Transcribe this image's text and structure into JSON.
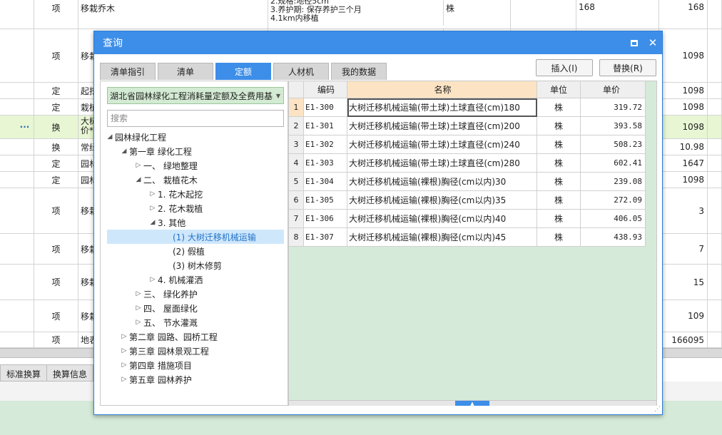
{
  "background": {
    "rows": [
      {
        "type": "项",
        "name": "移栽乔木",
        "spec": "2.规格:地径5cm\n3.养护期: 保存养护三个月\n4.1km内移植",
        "unit": "株",
        "qty": "168",
        "total": "168"
      },
      {
        "type": "项",
        "name": "移栽",
        "spec": "",
        "unit": "",
        "qty": "",
        "total": "1098"
      },
      {
        "type": "定",
        "name": "起挖",
        "spec": "",
        "unit": "",
        "qty": "",
        "total": "1098"
      },
      {
        "type": "定",
        "name": "栽植",
        "spec": "",
        "unit": "",
        "qty": "",
        "total": "1098"
      },
      {
        "type": "换",
        "name": "大树\n价*",
        "spec": "",
        "unit": "",
        "qty": "",
        "total": "1098",
        "dots": "···"
      },
      {
        "type": "换",
        "name": "常绿",
        "spec": "",
        "unit": "",
        "qty": "",
        "total": "10.98"
      },
      {
        "type": "定",
        "name": "园林",
        "spec": "",
        "unit": "",
        "qty": "",
        "total": "1647"
      },
      {
        "type": "定",
        "name": "园林",
        "spec": "",
        "unit": "",
        "qty": "",
        "total": "1098"
      },
      {
        "type": "项",
        "name": "移栽",
        "spec": "",
        "unit": "",
        "qty": "",
        "total": "3"
      },
      {
        "type": "项",
        "name": "移栽",
        "spec": "",
        "unit": "",
        "qty": "",
        "total": "7"
      },
      {
        "type": "项",
        "name": "移栽",
        "spec": "",
        "unit": "",
        "qty": "",
        "total": "15"
      },
      {
        "type": "项",
        "name": "移栽",
        "spec": "",
        "unit": "",
        "qty": "",
        "total": "109"
      },
      {
        "type": "项",
        "name": "地表",
        "spec": "",
        "unit": "",
        "qty": "",
        "total": "166095"
      }
    ],
    "bottom_tabs": [
      "标准换算",
      "换算信息"
    ]
  },
  "dialog": {
    "title": "查询",
    "tabs": [
      {
        "label": "清单指引",
        "active": false
      },
      {
        "label": "清单",
        "active": false
      },
      {
        "label": "定额",
        "active": true
      },
      {
        "label": "人材机",
        "active": false
      },
      {
        "label": "我的数据",
        "active": false
      }
    ],
    "insert_button": "插入(I)",
    "replace_button": "替换(R)",
    "library_select": "湖北省园林绿化工程消耗量定额及全费用基",
    "search_placeholder": "搜索",
    "tree": [
      {
        "label": "园林绿化工程",
        "toggle": "◢"
      },
      {
        "label": "第一章 绿化工程",
        "toggle": "◢"
      },
      {
        "label": "一、  绿地整理",
        "toggle": "▷"
      },
      {
        "label": "二、  栽植花木",
        "toggle": "◢"
      },
      {
        "label": "1. 花木起挖",
        "toggle": "▷"
      },
      {
        "label": "2. 花木栽植",
        "toggle": "▷"
      },
      {
        "label": "3. 其他",
        "toggle": "◢"
      },
      {
        "label": "(1) 大树迁移机械运输",
        "toggle": ""
      },
      {
        "label": "(2) 假植",
        "toggle": ""
      },
      {
        "label": "(3) 树木修剪",
        "toggle": ""
      },
      {
        "label": "4. 机械灌洒",
        "toggle": "▷"
      },
      {
        "label": "三、  绿化养护",
        "toggle": "▷"
      },
      {
        "label": "四、  屋面绿化",
        "toggle": "▷"
      },
      {
        "label": "五、  节水灌溉",
        "toggle": "▷"
      },
      {
        "label": "第二章 园路、园桥工程",
        "toggle": "▷"
      },
      {
        "label": "第三章 园林景观工程",
        "toggle": "▷"
      },
      {
        "label": "第四章 措施项目",
        "toggle": "▷"
      },
      {
        "label": "第五章 园林养护",
        "toggle": "▷"
      }
    ],
    "grid": {
      "headers": {
        "code": "编码",
        "name": "名称",
        "unit": "单位",
        "price": "单价"
      },
      "rows": [
        {
          "idx": "1",
          "code": "E1-300",
          "name": "大树迁移机械运输(带土球)土球直径(cm)180",
          "unit": "株",
          "price": "319.72"
        },
        {
          "idx": "2",
          "code": "E1-301",
          "name": "大树迁移机械运输(带土球)土球直径(cm)200",
          "unit": "株",
          "price": "393.58"
        },
        {
          "idx": "3",
          "code": "E1-302",
          "name": "大树迁移机械运输(带土球)土球直径(cm)240",
          "unit": "株",
          "price": "508.23"
        },
        {
          "idx": "4",
          "code": "E1-303",
          "name": "大树迁移机械运输(带土球)土球直径(cm)280",
          "unit": "株",
          "price": "602.41"
        },
        {
          "idx": "5",
          "code": "E1-304",
          "name": "大树迁移机械运输(裸根)胸径(cm以内)30",
          "unit": "株",
          "price": "239.08"
        },
        {
          "idx": "6",
          "code": "E1-305",
          "name": "大树迁移机械运输(裸根)胸径(cm以内)35",
          "unit": "株",
          "price": "272.09"
        },
        {
          "idx": "7",
          "code": "E1-306",
          "name": "大树迁移机械运输(裸根)胸径(cm以内)40",
          "unit": "株",
          "price": "406.05"
        },
        {
          "idx": "8",
          "code": "E1-307",
          "name": "大树迁移机械运输(裸根)胸径(cm以内)45",
          "unit": "株",
          "price": "438.93"
        }
      ]
    }
  }
}
